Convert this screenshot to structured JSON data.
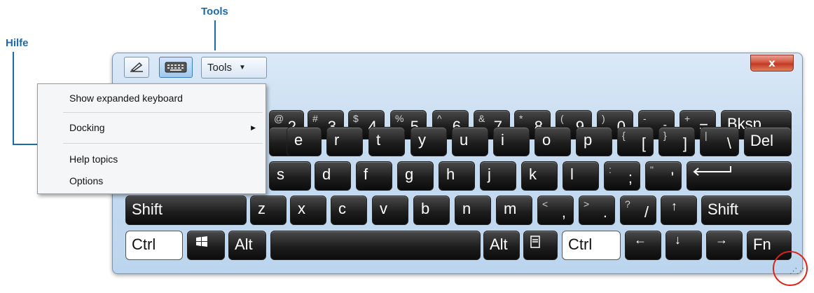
{
  "callouts": {
    "tools": "Tools",
    "help": "Hilfe"
  },
  "toolbar": {
    "tools_label": "Tools",
    "close_label": "x",
    "pen_icon": "pen-icon",
    "keyboard_icon": "keyboard-icon"
  },
  "menu": {
    "items": [
      {
        "label": "Show expanded keyboard"
      },
      {
        "label": "Docking",
        "has_submenu": true
      },
      {
        "label": "Help topics"
      },
      {
        "label": "Options"
      }
    ]
  },
  "keys": {
    "row1": [
      {
        "shift": "@",
        "main": "2"
      },
      {
        "shift": "#",
        "main": "3"
      },
      {
        "shift": "$",
        "main": "4"
      },
      {
        "shift": "%",
        "main": "5"
      },
      {
        "shift": "^",
        "main": "6"
      },
      {
        "shift": "&",
        "main": "7"
      },
      {
        "shift": "*",
        "main": "8"
      },
      {
        "shift": "(",
        "main": "9"
      },
      {
        "shift": ")",
        "main": "0"
      },
      {
        "shift": "-",
        "main": "-"
      },
      {
        "shift": "+",
        "main": "="
      },
      {
        "main": "Bksp"
      }
    ],
    "row2": [
      "e",
      "r",
      "t",
      "y",
      "u",
      "i",
      "o",
      "p",
      {
        "shift": "{",
        "main": "["
      },
      {
        "shift": "}",
        "main": "]"
      },
      {
        "shift": "|",
        "main": "\\"
      },
      "Del"
    ],
    "row3": [
      "s",
      "d",
      "f",
      "g",
      "h",
      "j",
      "k",
      "l",
      {
        "shift": ":",
        "main": ";"
      },
      {
        "shift": "\"",
        "main": "'"
      },
      "enter-arrow"
    ],
    "row4": [
      "Shift",
      "z",
      "x",
      "c",
      "v",
      "b",
      "n",
      "m",
      {
        "shift": "<",
        "main": ","
      },
      {
        "shift": ">",
        "main": "."
      },
      {
        "shift": "?",
        "main": "/"
      },
      "↑",
      "Shift"
    ],
    "row5": [
      "Ctrl",
      "windows-icon",
      "Alt",
      "space",
      "Alt",
      "menu-icon",
      "Ctrl",
      "←",
      "↓",
      "→",
      "Fn"
    ]
  },
  "colors": {
    "callout": "#1f6aa5",
    "close_button": "#c94a33",
    "highlight_circle": "#d9261c"
  }
}
